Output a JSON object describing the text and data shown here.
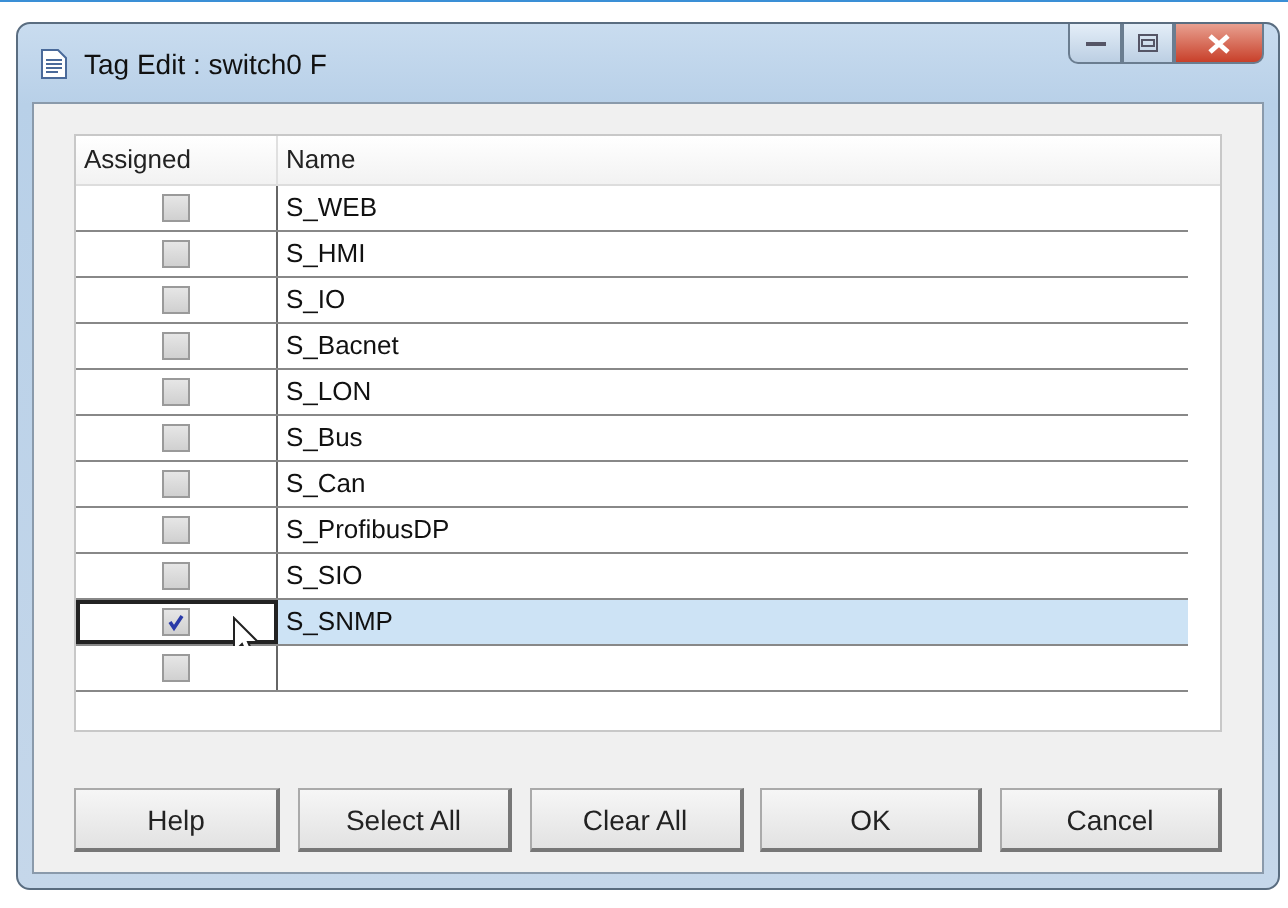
{
  "window": {
    "title": "Tag Edit : switch0 F"
  },
  "table": {
    "columns": [
      "Assigned",
      "Name"
    ],
    "rows": [
      {
        "name": "S_WEB",
        "checked": false,
        "selected": false
      },
      {
        "name": "S_HMI",
        "checked": false,
        "selected": false
      },
      {
        "name": "S_IO",
        "checked": false,
        "selected": false
      },
      {
        "name": "S_Bacnet",
        "checked": false,
        "selected": false
      },
      {
        "name": "S_LON",
        "checked": false,
        "selected": false
      },
      {
        "name": "S_Bus",
        "checked": false,
        "selected": false
      },
      {
        "name": "S_Can",
        "checked": false,
        "selected": false
      },
      {
        "name": "S_ProfibusDP",
        "checked": false,
        "selected": false
      },
      {
        "name": "S_SIO",
        "checked": false,
        "selected": false
      },
      {
        "name": "S_SNMP",
        "checked": true,
        "selected": true
      },
      {
        "checked": false,
        "selected": false
      }
    ]
  },
  "buttons": [
    "Help",
    "Select All",
    "Clear All",
    "OK",
    "Cancel"
  ]
}
